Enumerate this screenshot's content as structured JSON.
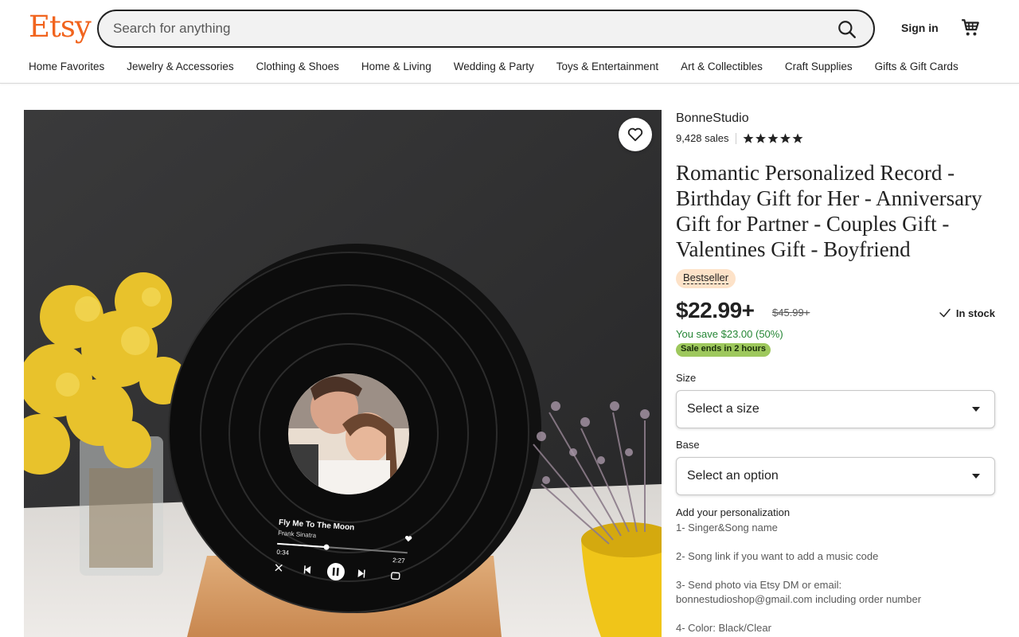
{
  "header": {
    "logo": "Etsy",
    "search_placeholder": "Search for anything",
    "sign_in": "Sign in",
    "nav": [
      "Home Favorites",
      "Jewelry & Accessories",
      "Clothing & Shoes",
      "Home & Living",
      "Wedding & Party",
      "Toys & Entertainment",
      "Art & Collectibles",
      "Craft Supplies",
      "Gifts & Gift Cards"
    ]
  },
  "listing": {
    "image": {
      "song_title": "Fly Me To The Moon",
      "artist": "Frank Sinatra",
      "time_elapsed": "0:34",
      "time_total": "2:27"
    },
    "shop_name": "BonneStudio",
    "sales": "9,428 sales",
    "rating_stars": 5,
    "title": "Romantic Personalized Record - Birthday Gift for Her - Anniversary Gift for Partner - Couples Gift - Valentines Gift - Boyfriend",
    "badge": "Bestseller",
    "price": "$22.99+",
    "original_price": "$45.99+",
    "stock": "In stock",
    "savings": "You save $23.00 (50%)",
    "sale_notice": "Sale ends in 2 hours",
    "size_label": "Size",
    "size_value": "Select a size",
    "base_label": "Base",
    "base_value": "Select an option",
    "personalization_title": "Add your personalization",
    "personalization_lines": [
      "1- Singer&Song name",
      "2- Song link if you want to add a music code",
      "3- Send photo via Etsy DM or email:",
      "bonnestudioshop@gmail.com including order number",
      "4- Color: Black/Clear"
    ]
  },
  "colors": {
    "brand": "#f1641e",
    "sale_green": "#258635",
    "sale_badge": "#9ec85d",
    "bestseller_bg": "#fde2c8"
  }
}
